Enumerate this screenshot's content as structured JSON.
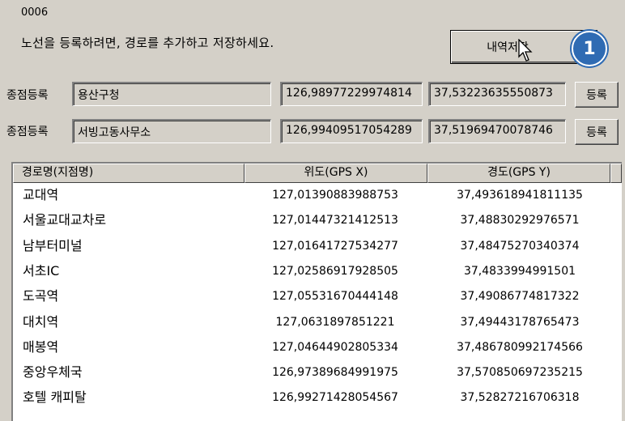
{
  "form_code": "0006",
  "instruction": "노선을 등록하려면, 경로를 추가하고 저장하세요.",
  "save_button": "내역저장",
  "badge": "1",
  "start": {
    "label": "종점등록",
    "name": "용산구청",
    "x": "126,98977229974814",
    "y": "37,53223635550873",
    "button": "등록"
  },
  "end": {
    "label": "종점등록",
    "name": "서빙고동사무소",
    "x": "126,99409517054289",
    "y": "37,51969470078746",
    "button": "등록"
  },
  "table": {
    "headers": [
      "경로명(지점명)",
      "위도(GPS X)",
      "경도(GPS Y)"
    ],
    "rows": [
      [
        "교대역",
        "127,01390883988753",
        "37,493618941811135"
      ],
      [
        "서울교대교차로",
        "127,01447321412513",
        "37,48830292976571"
      ],
      [
        "남부터미널",
        "127,01641727534277",
        "37,48475270340374"
      ],
      [
        "서초IC",
        "127,02586917928505",
        "37,4833994991501"
      ],
      [
        "도곡역",
        "127,05531670444148",
        "37,49086774817322"
      ],
      [
        "대치역",
        "127,0631897851221",
        "37,49443178765473"
      ],
      [
        "매봉역",
        "127,04644902805334",
        "37,486780992174566"
      ],
      [
        "중앙우체국",
        "126,97389684991975",
        "37,570850697235215"
      ],
      [
        "호텔 캐피탈",
        "126,99271428054567",
        "37,52827216706318"
      ]
    ]
  }
}
